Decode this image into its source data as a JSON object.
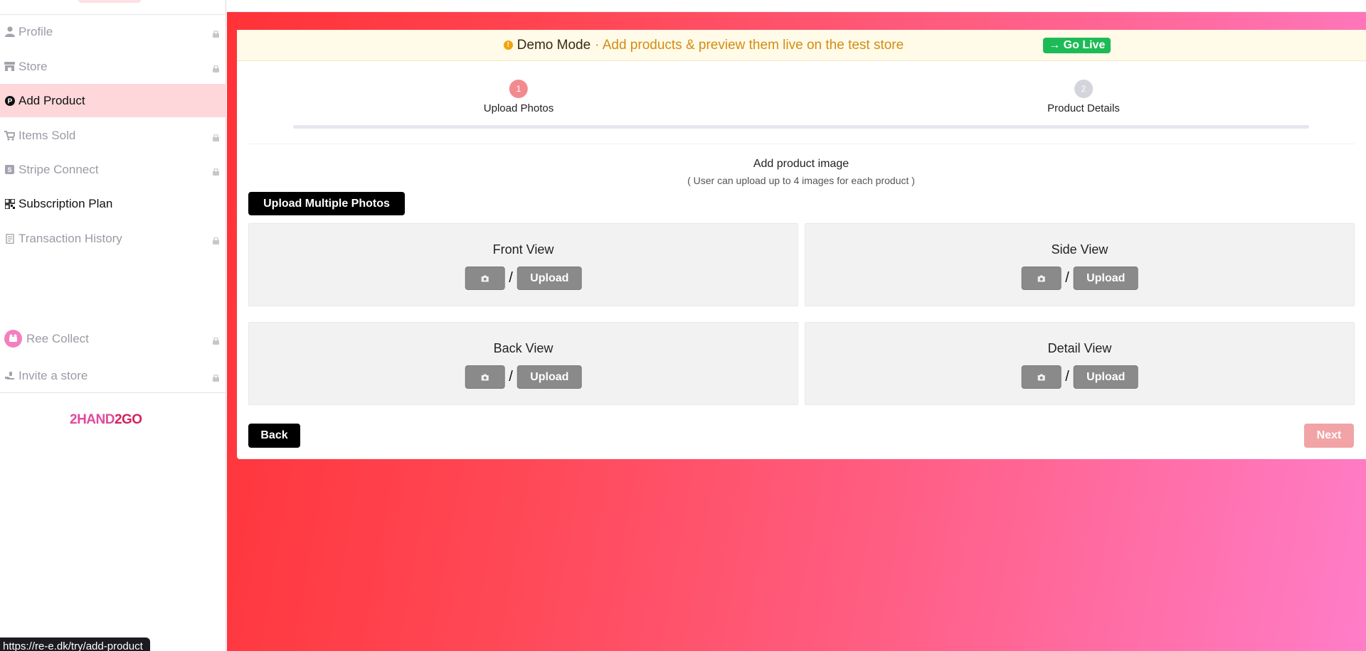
{
  "sidebar": {
    "items": [
      {
        "label": "Profile",
        "icon": "user-icon",
        "locked": true
      },
      {
        "label": "Store",
        "icon": "store-icon",
        "locked": true
      },
      {
        "label": "Add Product",
        "icon": "p-circle-icon",
        "locked": false,
        "active": true
      },
      {
        "label": "Items Sold",
        "icon": "cart-icon",
        "locked": true
      },
      {
        "label": "Stripe Connect",
        "icon": "stripe-icon",
        "locked": true
      },
      {
        "label": "Subscription Plan",
        "icon": "qr-icon",
        "locked": false
      },
      {
        "label": "Transaction History",
        "icon": "receipt-icon",
        "locked": true
      },
      {
        "label": "Ree Collect",
        "icon": "ree-collect-icon",
        "locked": true
      },
      {
        "label": "Invite a store",
        "icon": "hand-icon",
        "locked": true
      }
    ],
    "brand_part1": "2HAND",
    "brand_part2": "2GO"
  },
  "status_url": "https://re-e.dk/try/add-product",
  "demo": {
    "title": "Demo Mode",
    "message": "· Add products & preview them live on the test store",
    "go_live": "→ Go Live"
  },
  "steps": [
    {
      "number": "1",
      "label": "Upload Photos",
      "active": true
    },
    {
      "number": "2",
      "label": "Product Details",
      "active": false
    }
  ],
  "upload": {
    "title": "Add product image",
    "subtitle": "( User can upload up to 4 images for each product )",
    "multiple_button": "Upload Multiple Photos",
    "slot_separator": "/",
    "slots": [
      {
        "title": "Front View",
        "upload_label": "Upload"
      },
      {
        "title": "Side View",
        "upload_label": "Upload"
      },
      {
        "title": "Back View",
        "upload_label": "Upload"
      },
      {
        "title": "Detail View",
        "upload_label": "Upload"
      }
    ]
  },
  "nav": {
    "back": "Back",
    "next": "Next"
  },
  "colors": {
    "active_item_bg": "#fdd7da",
    "step_active": "#f28b90",
    "step_inactive": "#d4d4dc",
    "go_live_bg": "#1dbb56",
    "next_disabled": "#f2a3a5",
    "gradient_start": "#ff3237",
    "gradient_end": "#ff7dc8"
  }
}
